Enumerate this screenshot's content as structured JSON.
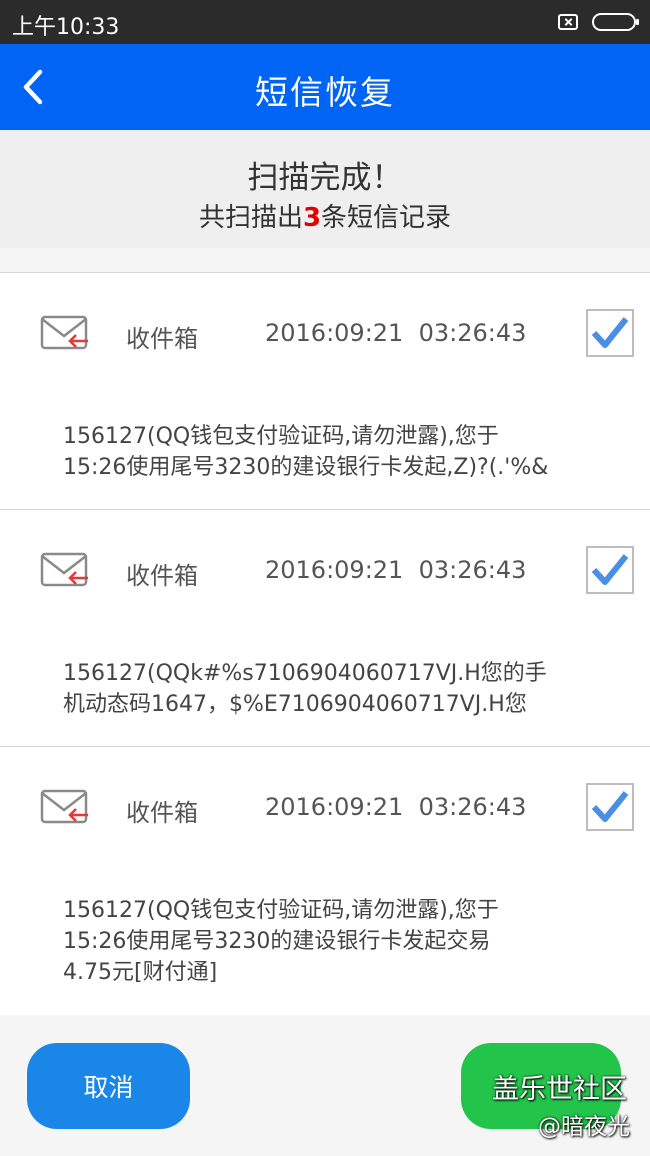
{
  "status_bar": {
    "time": "上午10:33"
  },
  "app_bar": {
    "title": "短信恢复"
  },
  "scan": {
    "title": "扫描完成！",
    "summary_prefix": "共扫描出",
    "count": "3",
    "summary_suffix": "条短信记录"
  },
  "messages": [
    {
      "folder": "收件箱",
      "time": "2016:09:21  03:26:43",
      "checked": true,
      "body": [
        "156127(QQ钱包支付验证码,请勿泄露),您于",
        "15:26使用尾号3230的建设银行卡发起,Z)?(.'%&"
      ]
    },
    {
      "folder": "收件箱",
      "time": "2016:09:21  03:26:43",
      "checked": true,
      "body": [
        "156127(QQk#%s7106904060717VJ.H您的手",
        "机动态码1647，$%E7106904060717VJ.H您"
      ]
    },
    {
      "folder": "收件箱",
      "time": "2016:09:21  03:26:43",
      "checked": true,
      "body": [
        "156127(QQ钱包支付验证码,请勿泄露),您于",
        "15:26使用尾号3230的建设银行卡发起交易",
        "4.75元[财付通]"
      ]
    }
  ],
  "buttons": {
    "cancel": "取消"
  },
  "watermark": {
    "line1": "盖乐世社区",
    "line2": "@暗夜光"
  },
  "colors": {
    "primary": "#0064f5",
    "cancel": "#1a86e8",
    "confirm": "#22c44a",
    "count": "#e00000",
    "check": "#4a8ee6"
  }
}
